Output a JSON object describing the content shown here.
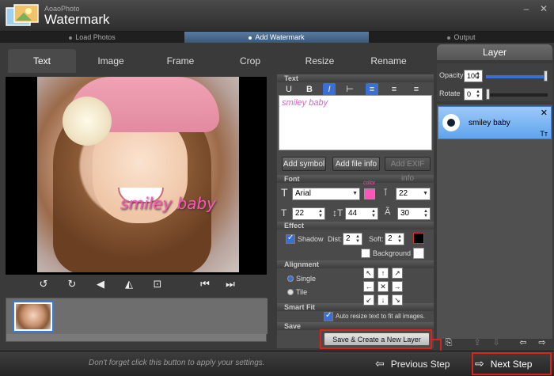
{
  "app": {
    "brand_small": "AoaoPhoto",
    "brand_big": "Watermark",
    "minimize_glyph": "–",
    "close_glyph": "✕"
  },
  "steps": [
    {
      "label": "Load Photos",
      "active": false
    },
    {
      "label": "Add Watermark",
      "active": true
    },
    {
      "label": "Output",
      "active": false
    }
  ],
  "tabs": [
    {
      "label": "Text",
      "active": true
    },
    {
      "label": "Image",
      "active": false
    },
    {
      "label": "Frame",
      "active": false
    },
    {
      "label": "Crop",
      "active": false
    },
    {
      "label": "Resize",
      "active": false
    },
    {
      "label": "Rename",
      "active": false
    }
  ],
  "preview": {
    "watermark_text": "smiley baby"
  },
  "transform_tools": {
    "rotate_left": "↺",
    "rotate_right": "↻",
    "flip_horizontal": "◀",
    "flip_vertical": "◭",
    "fit": "⊡",
    "prev": "⏮",
    "next": "⏭"
  },
  "text_section": {
    "label": "Text",
    "underline": "U",
    "bold": "B",
    "italic": "I",
    "vertical": "⊢",
    "align_left": "≡",
    "align_center": "≡",
    "align_right": "≡",
    "content": "smiley baby",
    "add_symbol": "Add symbol",
    "add_file_info": "Add file info",
    "add_exif_info": "Add EXIF info"
  },
  "font_section": {
    "label": "Font",
    "font_name": "Arial",
    "font_size": "22",
    "color_label": "color",
    "text_color": "#ff55bb",
    "width": "22",
    "line_height": "44",
    "spacing": "30"
  },
  "effect_section": {
    "label": "Effect",
    "shadow_label": "Shadow",
    "shadow_checked": true,
    "dist_label": "Dist:",
    "dist_value": "2",
    "soft_label": "Soft:",
    "soft_value": "2",
    "shadow_color": "#000000",
    "background_label": "Background",
    "background_checked": false,
    "background_color": "#ffffff"
  },
  "alignment_section": {
    "label": "Alignment",
    "single_label": "Single",
    "tile_label": "Tile",
    "grid": [
      "↖",
      "↑",
      "↗",
      "←",
      "✕",
      "→",
      "↙",
      "↓",
      "↘"
    ]
  },
  "smartfit_section": {
    "label": "Smart Fit",
    "auto_resize_label": "Auto resize text to fit all images.",
    "checked": true
  },
  "save_section": {
    "label": "Save",
    "save_button": "Save & Create a New Layer"
  },
  "layer_panel": {
    "title": "Layer",
    "opacity_label": "Opacity",
    "opacity_value": "100",
    "opacity_level": 1.0,
    "rotate_label": "Rotate",
    "rotate_value": "0",
    "rotate_level": 0.0,
    "layers": [
      {
        "name": "smiley baby",
        "type_icon": "Tт",
        "close": "✕"
      }
    ]
  },
  "bottom": {
    "hint": "Don't forget click this button to apply your settings.",
    "prev_label": "Previous Step",
    "next_label": "Next Step"
  },
  "colors": {
    "accent": "#3b6fd4",
    "highlight": "#d8231f",
    "watermark": "#ff55bb"
  }
}
